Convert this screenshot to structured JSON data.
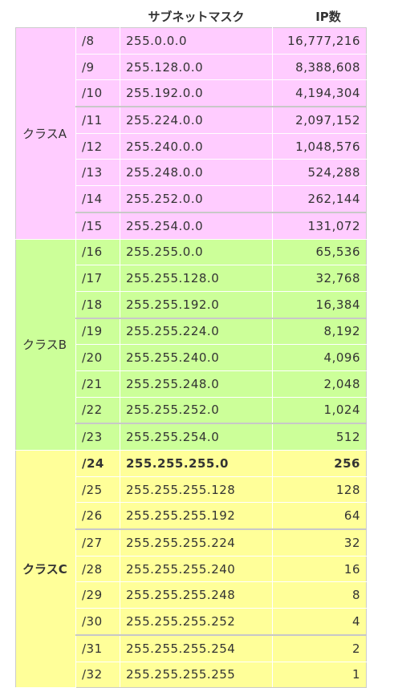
{
  "header": {
    "col_mask": "サブネットマスク",
    "col_ip": "IP数"
  },
  "groups": [
    {
      "name": "クラスA",
      "color": "#ffccff",
      "rows": [
        {
          "prefix": "/8",
          "mask": "255.0.0.0",
          "count": "16,777,216"
        },
        {
          "prefix": "/9",
          "mask": "255.128.0.0",
          "count": "8,388,608"
        },
        {
          "prefix": "/10",
          "mask": "255.192.0.0",
          "count": "4,194,304"
        },
        {
          "prefix": "/11",
          "mask": "255.224.0.0",
          "count": "2,097,152"
        },
        {
          "prefix": "/12",
          "mask": "255.240.0.0",
          "count": "1,048,576"
        },
        {
          "prefix": "/13",
          "mask": "255.248.0.0",
          "count": "524,288"
        },
        {
          "prefix": "/14",
          "mask": "255.252.0.0",
          "count": "262,144"
        },
        {
          "prefix": "/15",
          "mask": "255.254.0.0",
          "count": "131,072"
        }
      ]
    },
    {
      "name": "クラスB",
      "color": "#ccff99",
      "rows": [
        {
          "prefix": "/16",
          "mask": "255.255.0.0",
          "count": "65,536"
        },
        {
          "prefix": "/17",
          "mask": "255.255.128.0",
          "count": "32,768"
        },
        {
          "prefix": "/18",
          "mask": "255.255.192.0",
          "count": "16,384"
        },
        {
          "prefix": "/19",
          "mask": "255.255.224.0",
          "count": "8,192"
        },
        {
          "prefix": "/20",
          "mask": "255.255.240.0",
          "count": "4,096"
        },
        {
          "prefix": "/21",
          "mask": "255.255.248.0",
          "count": "2,048"
        },
        {
          "prefix": "/22",
          "mask": "255.255.252.0",
          "count": "1,024"
        },
        {
          "prefix": "/23",
          "mask": "255.255.254.0",
          "count": "512"
        }
      ]
    },
    {
      "name": "クラスC",
      "color": "#ffff99",
      "rows": [
        {
          "prefix": "/24",
          "mask": "255.255.255.0",
          "count": "256",
          "bold": true
        },
        {
          "prefix": "/25",
          "mask": "255.255.255.128",
          "count": "128"
        },
        {
          "prefix": "/26",
          "mask": "255.255.255.192",
          "count": "64"
        },
        {
          "prefix": "/27",
          "mask": "255.255.255.224",
          "count": "32"
        },
        {
          "prefix": "/28",
          "mask": "255.255.255.240",
          "count": "16"
        },
        {
          "prefix": "/29",
          "mask": "255.255.255.248",
          "count": "8"
        },
        {
          "prefix": "/30",
          "mask": "255.255.255.252",
          "count": "4"
        },
        {
          "prefix": "/31",
          "mask": "255.255.255.254",
          "count": "2"
        },
        {
          "prefix": "/32",
          "mask": "255.255.255.255",
          "count": "1"
        }
      ]
    }
  ]
}
